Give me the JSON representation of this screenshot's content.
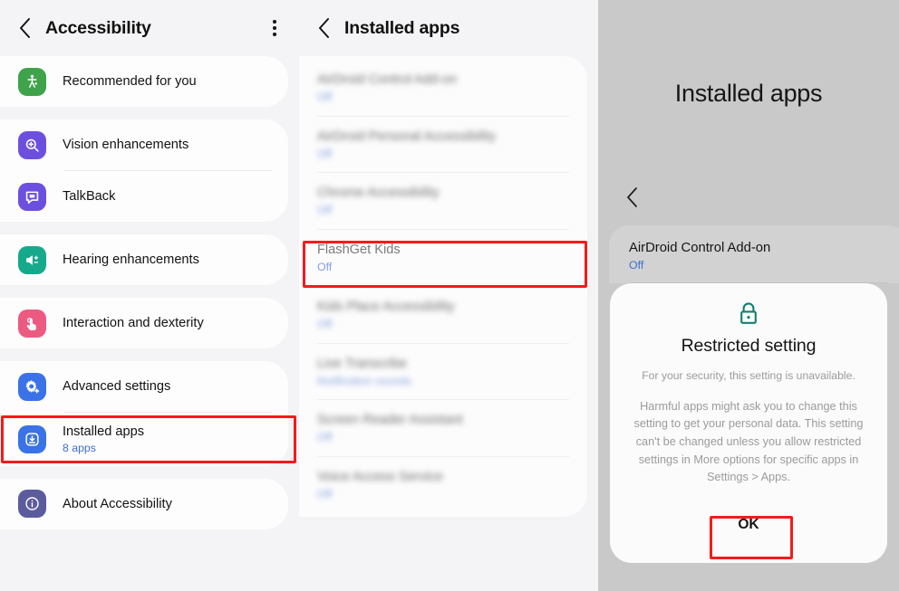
{
  "left_panel": {
    "header": {
      "back_icon": "chevron-left-icon",
      "title": "Accessibility",
      "more_icon": "kebab-menu-icon"
    },
    "groups": [
      {
        "items": [
          {
            "icon": "accessibility-person-icon",
            "icon_color": "#3ea34a",
            "label": "Recommended for you",
            "sub": ""
          }
        ]
      },
      {
        "items": [
          {
            "icon": "magnifier-plus-icon",
            "icon_color": "#6d4fe0",
            "label": "Vision enhancements",
            "sub": ""
          },
          {
            "icon": "speech-bubble-icon",
            "icon_color": "#6d4fe0",
            "label": "TalkBack",
            "sub": ""
          }
        ]
      },
      {
        "items": [
          {
            "icon": "speaker-volume-icon",
            "icon_color": "#17a98c",
            "label": "Hearing enhancements",
            "sub": ""
          }
        ]
      },
      {
        "items": [
          {
            "icon": "hand-tap-icon",
            "icon_color": "#ec5a81",
            "label": "Interaction and dexterity",
            "sub": ""
          }
        ]
      },
      {
        "items": [
          {
            "icon": "gear-plus-icon",
            "icon_color": "#3a72e8",
            "label": "Advanced settings",
            "sub": ""
          },
          {
            "icon": "download-box-icon",
            "icon_color": "#3a72e8",
            "label": "Installed apps",
            "sub": "8 apps"
          }
        ]
      },
      {
        "items": [
          {
            "icon": "info-circle-icon",
            "icon_color": "#5b5b9e",
            "label": "About Accessibility",
            "sub": ""
          }
        ]
      }
    ]
  },
  "mid_panel": {
    "header": {
      "back_icon": "chevron-left-icon",
      "title": "Installed apps"
    },
    "apps": [
      {
        "name": "AirDroid Control Add-on",
        "state": "Off",
        "blurred": true
      },
      {
        "name": "AirDroid Personal Accessibility",
        "state": "Off",
        "blurred": true
      },
      {
        "name": "Chrome Accessibility",
        "state": "Off",
        "blurred": true
      },
      {
        "name": "FlashGet Kids",
        "state": "Off",
        "blurred": false
      },
      {
        "name": "Kids Place Accessibility",
        "state": "Off",
        "blurred": true
      },
      {
        "name": "Live Transcribe",
        "state": "Notification sounds",
        "blurred": true
      },
      {
        "name": "Screen Reader Assistant",
        "state": "Off",
        "blurred": true
      },
      {
        "name": "Voice Access Service",
        "state": "Off",
        "blurred": true
      }
    ]
  },
  "right_panel": {
    "title": "Installed apps",
    "back_icon": "chevron-left-icon",
    "app": {
      "name": "AirDroid Control Add-on",
      "state": "Off"
    },
    "dialog": {
      "lock_icon": "lock-icon",
      "lock_color": "#11806e",
      "title": "Restricted setting",
      "body_1": "For your security, this setting is unavailable.",
      "body_2": "Harmful apps might ask you to change this setting to get your personal data. This setting can't be changed unless you allow restricted settings in More options for specific apps in Settings > Apps.",
      "ok_label": "OK"
    }
  },
  "highlights": {
    "color": "#f41b1b",
    "boxes": [
      {
        "name": "installed-apps-row-highlight"
      },
      {
        "name": "flashget-kids-row-highlight"
      },
      {
        "name": "ok-button-highlight"
      }
    ]
  }
}
